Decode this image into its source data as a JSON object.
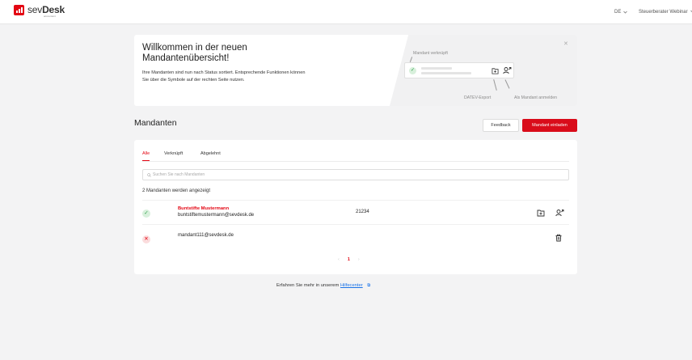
{
  "brand": {
    "name_light": "sev",
    "name_bold": "Desk",
    "tagline": "accountant",
    "accent": "#e30613"
  },
  "header": {
    "language": "DE",
    "user": "Steuerberater Webinar"
  },
  "welcome": {
    "title": "Willkommen in der neuen Mandantenübersicht!",
    "text": "Ihre Mandanten sind nun nach Status sortiert. Entsprechende Funktionen können Sie über die Symbole auf der rechten Seite nutzen.",
    "close_icon": "close-icon",
    "demo": {
      "label_linked": "Mandant verknüpft",
      "label_export": "DATEV-Export",
      "label_login": "Als Mandant anmelden"
    }
  },
  "section": {
    "title": "Mandanten",
    "feedback_label": "Feedback",
    "invite_label": "Mandant einladen"
  },
  "tabs": [
    {
      "label": "Alle",
      "active": true
    },
    {
      "label": "Verknüpft",
      "active": false
    },
    {
      "label": "Abgelehnt",
      "active": false
    }
  ],
  "search": {
    "placeholder": "Suchen Sie nach Mandanten",
    "value": ""
  },
  "count_text": "2 Mandanten werden angezeigt",
  "clients": [
    {
      "status": "linked",
      "name": "Buntstifte Mustermann",
      "email": "buntstiftemustermann@sevdesk.de",
      "number": "21234",
      "actions": [
        "datev-export-icon",
        "login-as-client-icon"
      ]
    },
    {
      "status": "rejected",
      "name": "",
      "email": "mandant111@sevdesk.de",
      "number": "",
      "actions": [
        "trash-icon"
      ]
    }
  ],
  "pagination": {
    "prev": "‹",
    "current": "1",
    "next": "›"
  },
  "help": {
    "text": "Erfahren Sie mehr in unserem",
    "link": "Hilfecenter"
  }
}
